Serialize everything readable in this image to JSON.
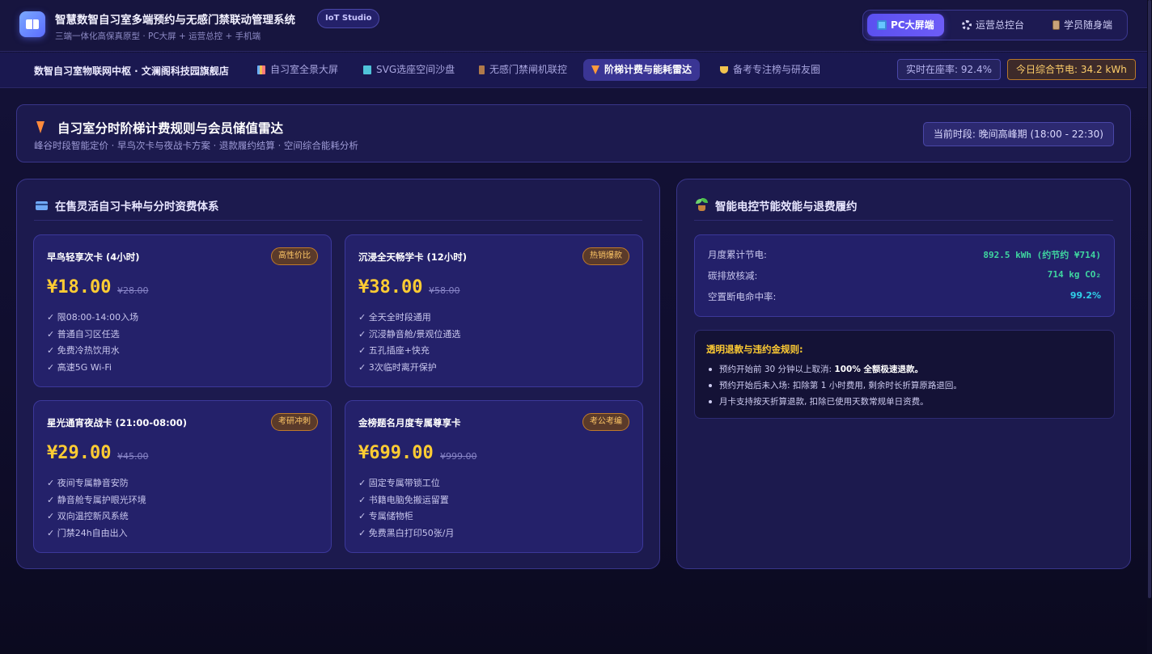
{
  "header": {
    "title": "智慧数智自习室多端预约与无感门禁联动管理系统",
    "badge": "IoT Studio",
    "subtitle": "三端一体化高保真原型 · PC大屏 + 运营总控 + 手机端",
    "modes": [
      {
        "label": "PC大屏端",
        "icon": "monitor-icon",
        "active": true
      },
      {
        "label": "运营总控台",
        "icon": "gear-icon",
        "active": false
      },
      {
        "label": "学员随身端",
        "icon": "phone-icon",
        "active": false
      }
    ]
  },
  "nav": {
    "brand": "数智自习室物联网中枢 · 文澜阁科技园旗舰店",
    "items": [
      {
        "label": "自习室全景大屏",
        "icon": "bar-chart-icon",
        "active": false
      },
      {
        "label": "SVG选座空间沙盘",
        "icon": "map-icon",
        "active": false
      },
      {
        "label": "无感门禁闸机联控",
        "icon": "door-icon",
        "active": false
      },
      {
        "label": "阶梯计费与能耗雷达",
        "icon": "lightning-icon",
        "active": true
      },
      {
        "label": "备考专注榜与研友圈",
        "icon": "trophy-icon",
        "active": false
      }
    ],
    "occupancy": "实时在座率: 92.4%",
    "energy_saved": "今日综合节电: 34.2 kWh"
  },
  "page": {
    "title": "自习室分时阶梯计费规则与会员储值雷达",
    "subtitle": "峰谷时段智能定价 · 早鸟次卡与夜战卡方案 · 退款履约结算 · 空间综合能耗分析",
    "current_period": "当前时段: 晚间高峰期 (18:00 - 22:30)"
  },
  "pricing": {
    "title": "在售灵活自习卡种与分时资费体系",
    "cards": [
      {
        "name": "早鸟轻享次卡 (4小时)",
        "tag": "高性价比",
        "price": "¥18.00",
        "original": "¥28.00",
        "features": [
          "✓ 限08:00-14:00入场",
          "✓ 普通自习区任选",
          "✓ 免费冷热饮用水",
          "✓ 高速5G Wi-Fi"
        ]
      },
      {
        "name": "沉浸全天畅学卡 (12小时)",
        "tag": "热销爆款",
        "price": "¥38.00",
        "original": "¥58.00",
        "features": [
          "✓ 全天全时段通用",
          "✓ 沉浸静音舱/景观位通选",
          "✓ 五孔插座+快充",
          "✓ 3次临时离开保护"
        ]
      },
      {
        "name": "星光通宵夜战卡 (21:00-08:00)",
        "tag": "考研冲刺",
        "price": "¥29.00",
        "original": "¥45.00",
        "features": [
          "✓ 夜间专属静音安防",
          "✓ 静音舱专属护眼光环境",
          "✓ 双向温控新风系统",
          "✓ 门禁24h自由出入"
        ]
      },
      {
        "name": "金榜题名月度专属尊享卡",
        "tag": "考公考编",
        "price": "¥699.00",
        "original": "¥999.00",
        "features": [
          "✓ 固定专属带锁工位",
          "✓ 书籍电脑免搬运留置",
          "✓ 专属储物柜",
          "✓ 免费黑白打印50张/月"
        ]
      }
    ]
  },
  "energy": {
    "title": "智能电控节能效能与退费履约",
    "stats": [
      {
        "label": "月度累计节电:",
        "value": "892.5 kWh (约节约 ¥714)"
      },
      {
        "label": "碳排放核减:",
        "value": "714 kg CO₂"
      },
      {
        "label": "空置断电命中率:",
        "value": "99.2%"
      }
    ],
    "rules_title": "透明退款与违约金规则:",
    "rules": [
      {
        "text": "预约开始前 30 分钟以上取消: ",
        "strong": "100% 全额极速退款。"
      },
      {
        "text": "预约开始后未入场: 扣除第 1 小时费用, 剩余时长折算原路退回。",
        "strong": ""
      },
      {
        "text": "月卡支持按天折算退款, 扣除已使用天数常规单日资费。",
        "strong": ""
      }
    ]
  },
  "colors": {
    "accent": "#5b50f0",
    "price": "#ffcc33",
    "green": "#3fd6a0",
    "cyan": "#2fd0e8",
    "tag": "#ffc766"
  }
}
